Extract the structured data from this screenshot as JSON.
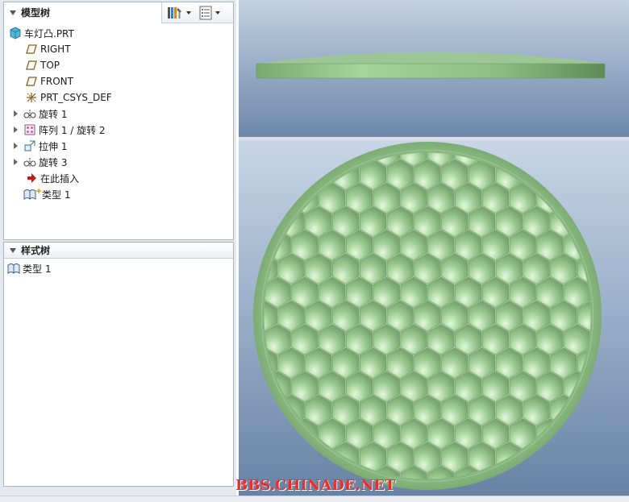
{
  "model_tree": {
    "title": "模型树",
    "items": [
      {
        "label": "车灯凸.PRT",
        "icon": "part-icon"
      },
      {
        "label": "RIGHT",
        "icon": "datum-plane-icon"
      },
      {
        "label": "TOP",
        "icon": "datum-plane-icon"
      },
      {
        "label": "FRONT",
        "icon": "datum-plane-icon"
      },
      {
        "label": "PRT_CSYS_DEF",
        "icon": "csys-icon"
      },
      {
        "label": "旋转 1",
        "icon": "revolve-icon"
      },
      {
        "label": "阵列 1 / 旋转 2",
        "icon": "pattern-icon"
      },
      {
        "label": "拉伸 1",
        "icon": "extrude-icon"
      },
      {
        "label": "旋转 3",
        "icon": "revolve-icon"
      },
      {
        "label": "在此插入",
        "icon": "insert-here-arrow-icon"
      },
      {
        "label": "类型 1",
        "icon": "style-type-icon"
      }
    ]
  },
  "style_tree": {
    "title": "样式树",
    "items": [
      {
        "label": "类型 1",
        "icon": "style-type-icon"
      }
    ]
  },
  "toolbar_icons": [
    "settings-tools-icon",
    "tree-columns-icon"
  ],
  "watermark": "BBS.CHINADE.NET",
  "colors": {
    "model_green": "#9cc795",
    "viewport_sky": "#8ea4c0",
    "watermark_red": "#f02a2a"
  }
}
